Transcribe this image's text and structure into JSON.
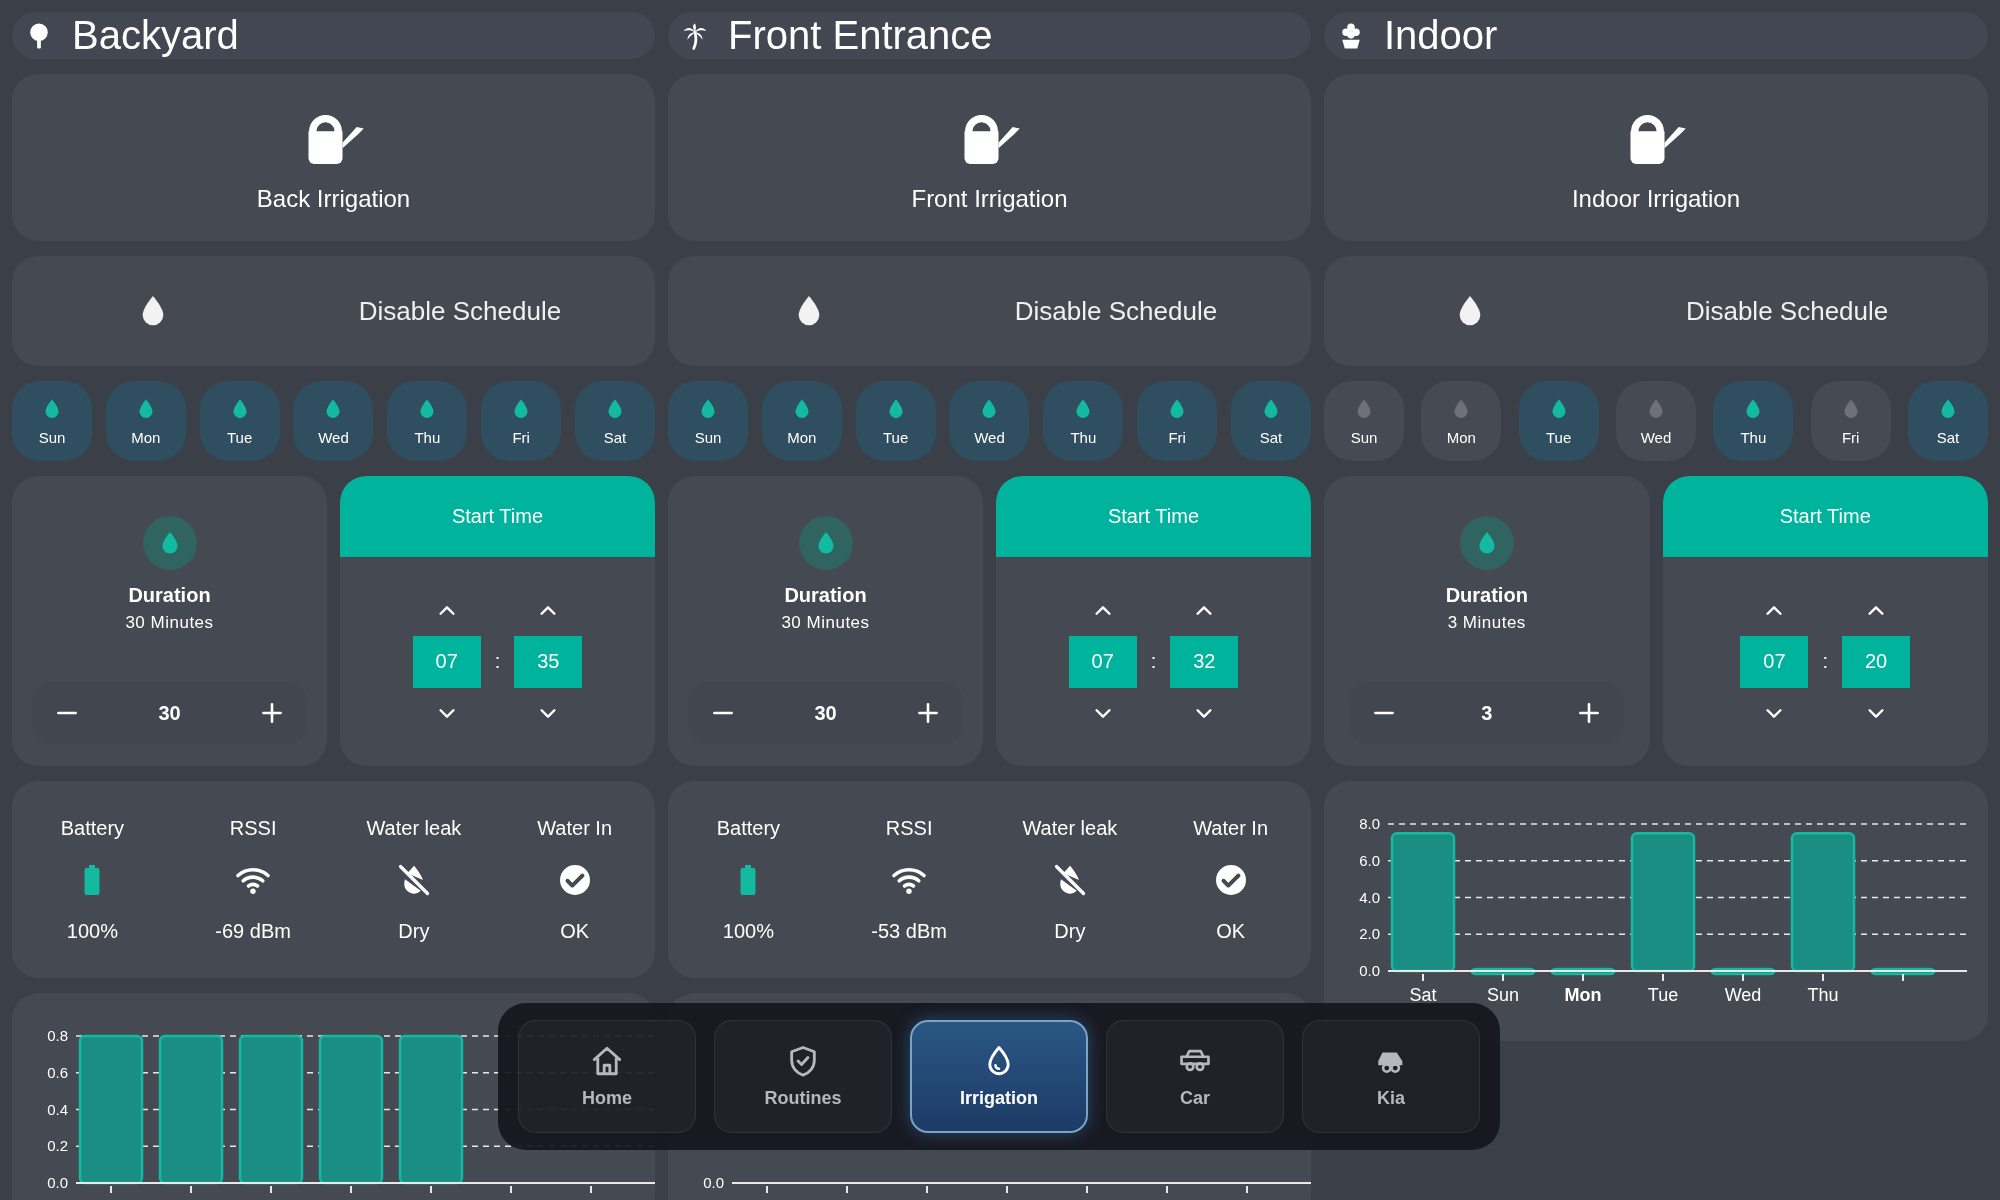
{
  "zones": [
    {
      "name": "Backyard",
      "valve": "Back Irrigation",
      "schedule": "Disable Schedule",
      "days": [
        {
          "label": "Sun",
          "selected": true
        },
        {
          "label": "Mon",
          "selected": true
        },
        {
          "label": "Tue",
          "selected": true
        },
        {
          "label": "Wed",
          "selected": true
        },
        {
          "label": "Thu",
          "selected": true
        },
        {
          "label": "Fri",
          "selected": true
        },
        {
          "label": "Sat",
          "selected": true
        }
      ],
      "duration": {
        "title": "Duration",
        "subtitle": "30 Minutes",
        "value": "30"
      },
      "start_time": {
        "title": "Start Time",
        "hour": "07",
        "separator": ":",
        "minute": "35"
      },
      "sensors": [
        {
          "kind": "battery",
          "label": "Battery",
          "value": "100%"
        },
        {
          "kind": "wifi",
          "label": "RSSI",
          "value": "-69 dBm"
        },
        {
          "kind": "leak",
          "label": "Water leak",
          "value": "Dry"
        },
        {
          "kind": "check",
          "label": "Water In",
          "value": "OK"
        }
      ],
      "chart": {
        "chart_data": {
          "type": "bar",
          "grid": true,
          "values": [
            0.8,
            0.8,
            0.8,
            0.8,
            0.8,
            null,
            null
          ],
          "ylim": [
            0,
            0.8
          ],
          "yticks": [
            {
              "value": 0,
              "label": "0.0"
            },
            {
              "value": 0.2,
              "label": "0.2"
            },
            {
              "value": 0.4,
              "label": "0.4"
            },
            {
              "value": 0.6,
              "label": "0.6"
            },
            {
              "value": 0.8,
              "label": "0.8"
            }
          ]
        }
      }
    },
    {
      "name": "Front Entrance",
      "valve": "Front Irrigation",
      "schedule": "Disable Schedule",
      "days": [
        {
          "label": "Sun",
          "selected": true
        },
        {
          "label": "Mon",
          "selected": true
        },
        {
          "label": "Tue",
          "selected": true
        },
        {
          "label": "Wed",
          "selected": true
        },
        {
          "label": "Thu",
          "selected": true
        },
        {
          "label": "Fri",
          "selected": true
        },
        {
          "label": "Sat",
          "selected": true
        }
      ],
      "duration": {
        "title": "Duration",
        "subtitle": "30 Minutes",
        "value": "30"
      },
      "start_time": {
        "title": "Start Time",
        "hour": "07",
        "separator": ":",
        "minute": "32"
      },
      "sensors": [
        {
          "kind": "battery",
          "label": "Battery",
          "value": "100%"
        },
        {
          "kind": "wifi",
          "label": "RSSI",
          "value": "-53 dBm"
        },
        {
          "kind": "leak",
          "label": "Water leak",
          "value": "Dry"
        },
        {
          "kind": "check",
          "label": "Water In",
          "value": "OK"
        }
      ],
      "chart": {
        "axis_label": "0.0"
      }
    },
    {
      "name": "Indoor",
      "valve": "Indoor Irrigation",
      "schedule": "Disable Schedule",
      "days": [
        {
          "label": "Sun",
          "selected": false
        },
        {
          "label": "Mon",
          "selected": false
        },
        {
          "label": "Tue",
          "selected": true
        },
        {
          "label": "Wed",
          "selected": false
        },
        {
          "label": "Thu",
          "selected": true
        },
        {
          "label": "Fri",
          "selected": false
        },
        {
          "label": "Sat",
          "selected": true
        }
      ],
      "duration": {
        "title": "Duration",
        "subtitle": "3 Minutes",
        "value": "3"
      },
      "start_time": {
        "title": "Start Time",
        "hour": "07",
        "separator": ":",
        "minute": "20"
      },
      "chart": {
        "chart_data": {
          "type": "bar",
          "grid": true,
          "categories": [
            "Sat",
            "Sun",
            "**Mon**",
            "Tue",
            "Wed",
            "Thu",
            null
          ],
          "values": [
            7.5,
            0,
            0,
            7.5,
            0,
            7.5,
            0
          ],
          "ylim": [
            0,
            8
          ],
          "yticks": [
            {
              "value": 0,
              "label": "0.0"
            },
            {
              "value": 2,
              "label": "2.0"
            },
            {
              "value": 4,
              "label": "4.0"
            },
            {
              "value": 6,
              "label": "6.0"
            },
            {
              "value": 8,
              "label": "8.0"
            }
          ]
        }
      }
    }
  ],
  "nav": [
    {
      "label": "Home",
      "selected": false
    },
    {
      "label": "Routines",
      "selected": false
    },
    {
      "label": "Irrigation",
      "selected": true
    },
    {
      "label": "Car",
      "selected": false
    },
    {
      "label": "Kia",
      "selected": false
    }
  ]
}
